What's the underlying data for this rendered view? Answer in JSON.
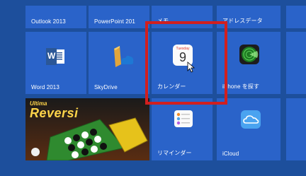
{
  "tiles": {
    "outlook": {
      "label": "Outlook 2013"
    },
    "powerpoint": {
      "label": "PowerPoint 201"
    },
    "memo": {
      "label": "メモ"
    },
    "address": {
      "label": "アドレスデータ"
    },
    "word": {
      "label": "Word 2013",
      "icon_text": "W"
    },
    "skydrive": {
      "label": "SkyDrive"
    },
    "calendar": {
      "label": "カレンダー",
      "day_name": "Tuesday",
      "day_number": "9"
    },
    "findiphone": {
      "label": "iPhone を探す"
    },
    "reminders": {
      "label": "リマインダー"
    },
    "icloud": {
      "label": "iCloud"
    },
    "reversi": {
      "title_top": "Ultima",
      "title_main": "Reversi"
    }
  },
  "colors": {
    "background": "#1d4f9c",
    "tile": "#2a63c9",
    "highlight": "#d11f1f"
  }
}
